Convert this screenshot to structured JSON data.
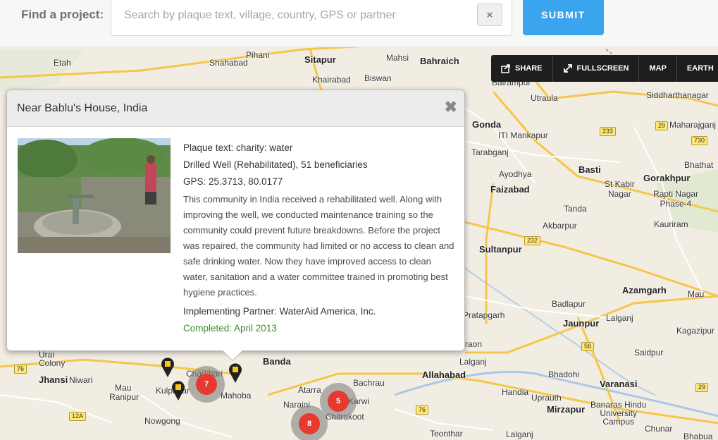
{
  "search": {
    "label": "Find a project:",
    "placeholder": "Search by plaque text, village, country, GPS or partner",
    "value": "",
    "clear_glyph": "×",
    "submit_label": "SUBMIT"
  },
  "toolbar": {
    "share_label": "SHARE",
    "fullscreen_label": "FULLSCREEN",
    "map_label": "MAP",
    "earth_label": "EARTH"
  },
  "popup": {
    "title": "Near Bablu's House, India",
    "close_glyph": "✖",
    "plaque": "Plaque text: charity: water",
    "project": "Drilled Well (Rehabilitated), 51 beneficiaries",
    "gps": "GPS: 25.3713, 80.0177",
    "description": "This community in India received a rehabilitated well. Along with improving the well, we conducted maintenance training so the community could prevent future breakdowns. Before the project was repaired, the community had limited or no access to clean and safe drinking water. Now they have improved access to clean water, sanitation and a water committee trained in promoting best hygiene practices.",
    "partner": "Implementing Partner: WaterAid America, Inc.",
    "completed": "Completed: April 2013"
  },
  "places": {
    "etah": "Etah",
    "shahabad": "Shahabad",
    "pihani": "Pihani",
    "sitapur": "Sitapur",
    "mahsi": "Mahsi",
    "bahraich": "Bahraich",
    "khairabad": "Khairabad",
    "biswan": "Biswan",
    "balrampur": "Balrampur",
    "utraula": "Utraula",
    "siddharthanagar": "Siddharthanagar",
    "gonda": "Gonda",
    "iti_mankapur": "ITI Mankapur",
    "maharajganj": "Maharajganj",
    "tarabganj": "Tarabganj",
    "basti": "Basti",
    "bhathat": "Bhathat",
    "ayodhya": "Ayodhya",
    "faizabad": "Faizabad",
    "gorakhpur": "Gorakhpur",
    "st_kabir_nagar": "St Kabir\nNagar",
    "rapti_nagar": "Rapti Nagar\nPhase-4",
    "tanda": "Tanda",
    "akbarpur": "Akbarpur",
    "kauriram": "Kauriram",
    "sultanpur": "Sultanpur",
    "azamgarh": "Azamgarh",
    "mau": "Mau",
    "badlapur": "Badlapur",
    "pratapgarh": "Pratapgarh",
    "lalganj": "Lalganj",
    "jaunpur": "Jaunpur",
    "kagazipur": "Kagazipur",
    "saidpur": "Saidpur",
    "allahabad": "Allahabad",
    "bhadohi": "Bhadohi",
    "varanasi": "Varanasi",
    "handia": "Handia",
    "urai": "Urai",
    "colony": "Colony",
    "jhansi": "Jhansi",
    "niwari": "Niwari",
    "mau_sw": "Mau",
    "ranipur": "Ranipur",
    "kulpahar": "Kulpahar",
    "charkhari": "Charkhari",
    "mahoba": "Mahoba",
    "banda": "Banda",
    "atarra": "Atarra",
    "bachrau": "Bachrau",
    "naraini": "Naraini",
    "chitrakoot": "Chitrakoot",
    "karwi": "Karwi",
    "nowgong": "Nowgong",
    "uprauth": "Uprauth",
    "mirzapur": "Mirzapur",
    "bhu": "Banaras Hindu\nUniversity\nCampus",
    "teonthar": "Teonthar",
    "lalganj2": "Lalganj",
    "chunar": "Chunar",
    "bhabua": "Bhabua",
    "jaunpur_sub": "Jaunpur",
    "saraon": "raon"
  },
  "clusters": [
    {
      "count": "7"
    },
    {
      "count": "5"
    },
    {
      "count": "8"
    }
  ],
  "colors": {
    "submit": "#3aa5ee",
    "completed": "#3c8a2e",
    "cluster_core": "#e63a2e",
    "toolbar_bg": "#1e1e1e"
  }
}
